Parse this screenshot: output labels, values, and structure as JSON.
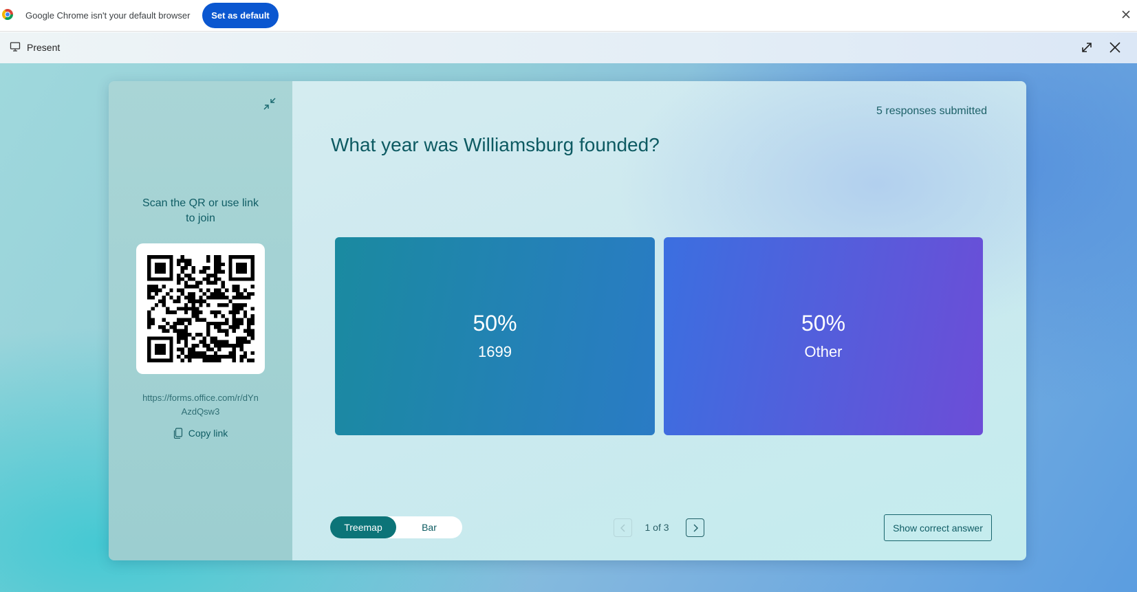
{
  "browser_bar": {
    "message": "Google Chrome isn't your default browser",
    "set_default_label": "Set as default"
  },
  "present_bar": {
    "label": "Present"
  },
  "join_panel": {
    "scan_text_line1": "Scan the QR or use link",
    "scan_text_line2": "to join",
    "link_line1": "https://forms.office.com/r/dYn",
    "link_line2": "AzdQsw3",
    "copy_label": "Copy link"
  },
  "results": {
    "responses_text": "5 responses submitted",
    "question": "What year was Williamsburg founded?",
    "tiles": [
      {
        "percent": "50%",
        "label": "1699"
      },
      {
        "percent": "50%",
        "label": "Other"
      }
    ]
  },
  "controls": {
    "view_options": [
      "Treemap",
      "Bar"
    ],
    "selected_view": "Treemap",
    "page_text": "1 of 3",
    "show_answer_label": "Show correct answer"
  },
  "colors": {
    "primary_teal": "#0c7478",
    "accent_blue": "#0b57d0",
    "tile_1_gradient": [
      "#1a8aa0",
      "#2a7bc5"
    ],
    "tile_2_gradient": [
      "#3b6fe0",
      "#6c4dd7"
    ]
  }
}
